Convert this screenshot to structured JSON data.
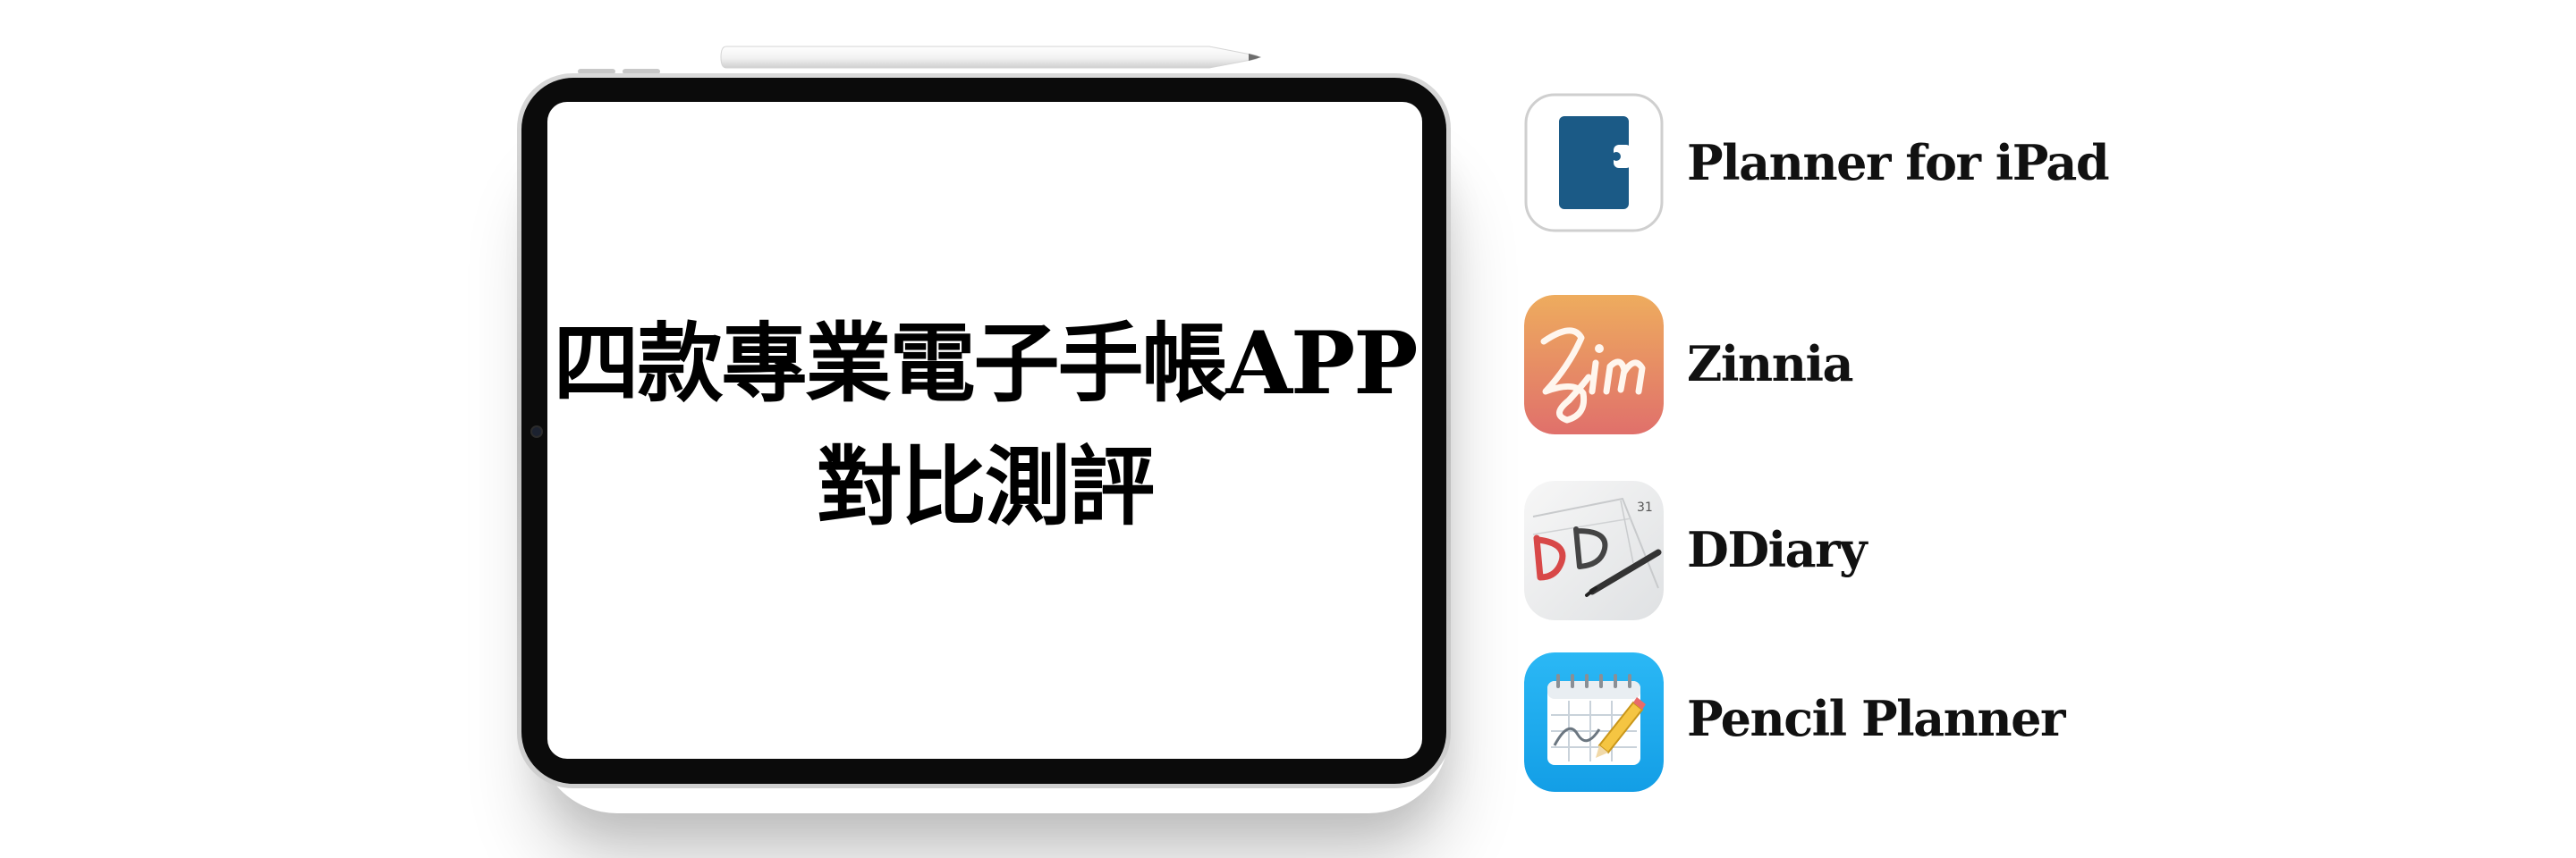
{
  "headline": {
    "line1": "四款專業電子手帳APP",
    "line2": "對比測評"
  },
  "apps": [
    {
      "name": "Planner for iPad",
      "icon": "planner-for-ipad-app-icon",
      "color": "#1b5a86"
    },
    {
      "name": "Zinnia",
      "icon": "zinnia-app-icon",
      "color": "#e07a6b"
    },
    {
      "name": "DDiary",
      "icon": "ddiary-app-icon",
      "color": "#e4e6e8",
      "icon_calendar_day": "31"
    },
    {
      "name": "Pencil Planner",
      "icon": "pencil-planner-app-icon",
      "color": "#1ea7f0"
    }
  ]
}
